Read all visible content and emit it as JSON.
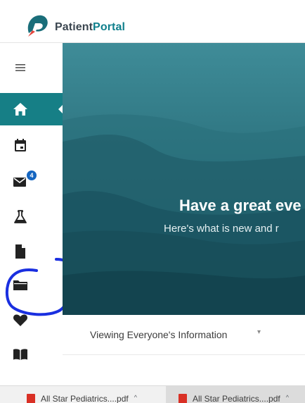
{
  "app": {
    "name_part1": "Patient",
    "name_part2": "Portal"
  },
  "sidebar": {
    "items": [
      {
        "icon": "menu-icon"
      },
      {
        "icon": "home-icon",
        "active": true
      },
      {
        "icon": "calendar-icon"
      },
      {
        "icon": "mail-icon",
        "badge": "4"
      },
      {
        "icon": "flask-icon"
      },
      {
        "icon": "document-icon"
      },
      {
        "icon": "folder-icon"
      },
      {
        "icon": "heart-icon"
      },
      {
        "icon": "book-icon"
      }
    ]
  },
  "hero": {
    "title": "Have a great eve",
    "subtitle": "Here's what is new and r"
  },
  "viewing": {
    "label": "Viewing Everyone's Information",
    "caret": "▾"
  },
  "downloads": [
    {
      "label": "All Star Pediatrics....pdf",
      "caret": "^"
    },
    {
      "label": "All Star Pediatrics....pdf",
      "caret": "^"
    }
  ],
  "colors": {
    "brand": "#167f86",
    "badge": "#1565c0",
    "annotation": "#1a2fe0",
    "logo_red": "#e2453c"
  }
}
